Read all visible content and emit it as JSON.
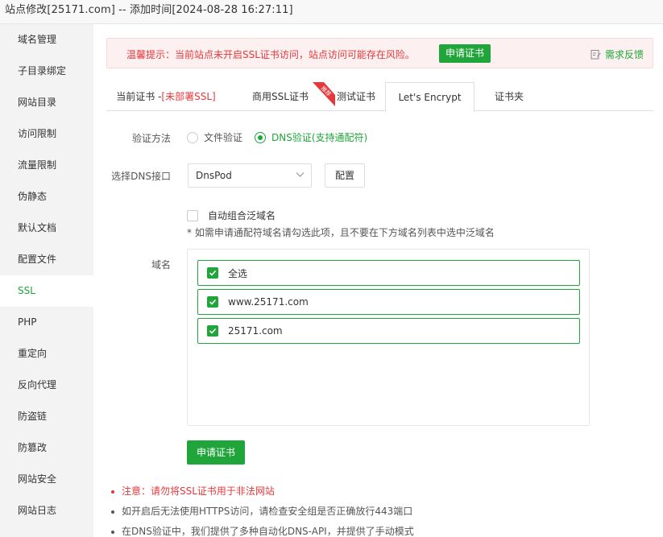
{
  "window": {
    "title": "站点修改[25171.com] -- 添加时间[2024-08-28 16:27:11]"
  },
  "sidebar": {
    "items": [
      {
        "label": "域名管理"
      },
      {
        "label": "子目录绑定"
      },
      {
        "label": "网站目录"
      },
      {
        "label": "访问限制"
      },
      {
        "label": "流量限制"
      },
      {
        "label": "伪静态"
      },
      {
        "label": "默认文档"
      },
      {
        "label": "配置文件"
      },
      {
        "label": "SSL"
      },
      {
        "label": "PHP"
      },
      {
        "label": "重定向"
      },
      {
        "label": "反向代理"
      },
      {
        "label": "防盗链"
      },
      {
        "label": "防篡改"
      },
      {
        "label": "网站安全"
      },
      {
        "label": "网站日志"
      }
    ],
    "active": "SSL"
  },
  "alert": {
    "text": "温馨提示：当前站点未开启SSL证书访问，站点访问可能存在风险。",
    "button": "申请证书",
    "feedback": "需求反馈"
  },
  "tabs": {
    "current_prefix": "当前证书 -",
    "current_status": "[未部署SSL]",
    "commercial": "商用SSL证书",
    "ribbon": "推荐",
    "test": "测试证书",
    "letsencrypt": "Let's Encrypt",
    "folder": "证书夹"
  },
  "form": {
    "verify_label": "验证方法",
    "verify_file": "文件验证",
    "verify_dns": "DNS验证(支持通配符)",
    "dns_label": "选择DNS接口",
    "dns_value": "DnsPod",
    "config_button": "配置",
    "wildcard_label": "自动组合泛域名",
    "wildcard_hint": "* 如需申请通配符域名请勾选此项，且不要在下方域名列表中选中泛域名",
    "domain_label": "域名",
    "domains": [
      "全选",
      "www.25171.com",
      "25171.com"
    ],
    "apply_button": "申请证书"
  },
  "notes": [
    "注意：请勿将SSL证书用于非法网站",
    "如开启后无法使用HTTPS访问，请检查安全组是否正确放行443端口",
    "在DNS验证中，我们提供了多种自动化DNS-API，并提供了手动模式"
  ],
  "colors": {
    "accent": "#20a53a",
    "danger": "#e4393c",
    "alert_bg": "#fdf0f0"
  }
}
